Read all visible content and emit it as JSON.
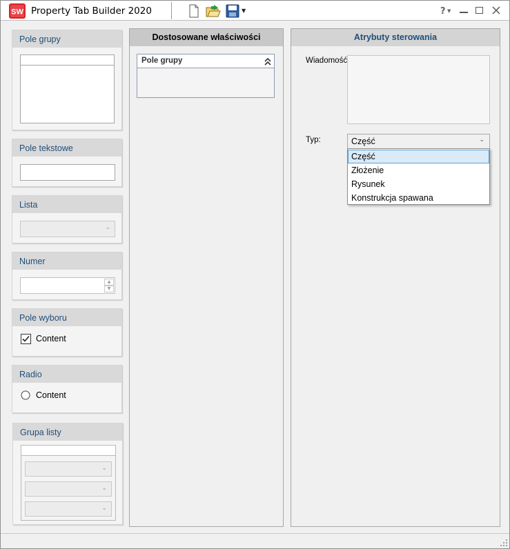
{
  "window": {
    "title": "Property Tab Builder   2020",
    "logo_text": "SW",
    "accent_red": "#d8232a"
  },
  "toolbar": {
    "icons": [
      "new-file-icon",
      "open-folder-icon",
      "save-icon",
      "save-dropdown-arrow-icon"
    ],
    "help_label": "?",
    "help_icon": "help-icon",
    "minimize_icon": "minimize-icon",
    "maximize_icon": "maximize-icon",
    "close_icon": "close-icon"
  },
  "palette": {
    "group_box": {
      "title": "Pole grupy"
    },
    "text_box": {
      "title": "Pole tekstowe",
      "value": ""
    },
    "list": {
      "title": "Lista",
      "value": ""
    },
    "number": {
      "title": "Numer",
      "value": ""
    },
    "checkbox": {
      "title": "Pole wyboru",
      "label": "Content",
      "checked": true
    },
    "radio": {
      "title": "Radio",
      "label": "Content",
      "checked": false
    },
    "list_group": {
      "title": "Grupa listy",
      "combos": [
        "",
        "",
        ""
      ]
    }
  },
  "custom_properties": {
    "header": "Dostosowane właściwości",
    "group": {
      "title": "Pole grupy",
      "collapse_icon": "double-chevron-up-icon"
    }
  },
  "control_attributes": {
    "header": "Atrybuty sterowania",
    "header_color": "#1f4e79",
    "message_label": "Wiadomość:",
    "message_value": "",
    "type_label": "Typ:",
    "type_selected": "Część",
    "type_options": [
      "Część",
      "Złożenie",
      "Rysunek",
      "Konstrukcja spawana"
    ],
    "type_highlighted_index": 0
  }
}
